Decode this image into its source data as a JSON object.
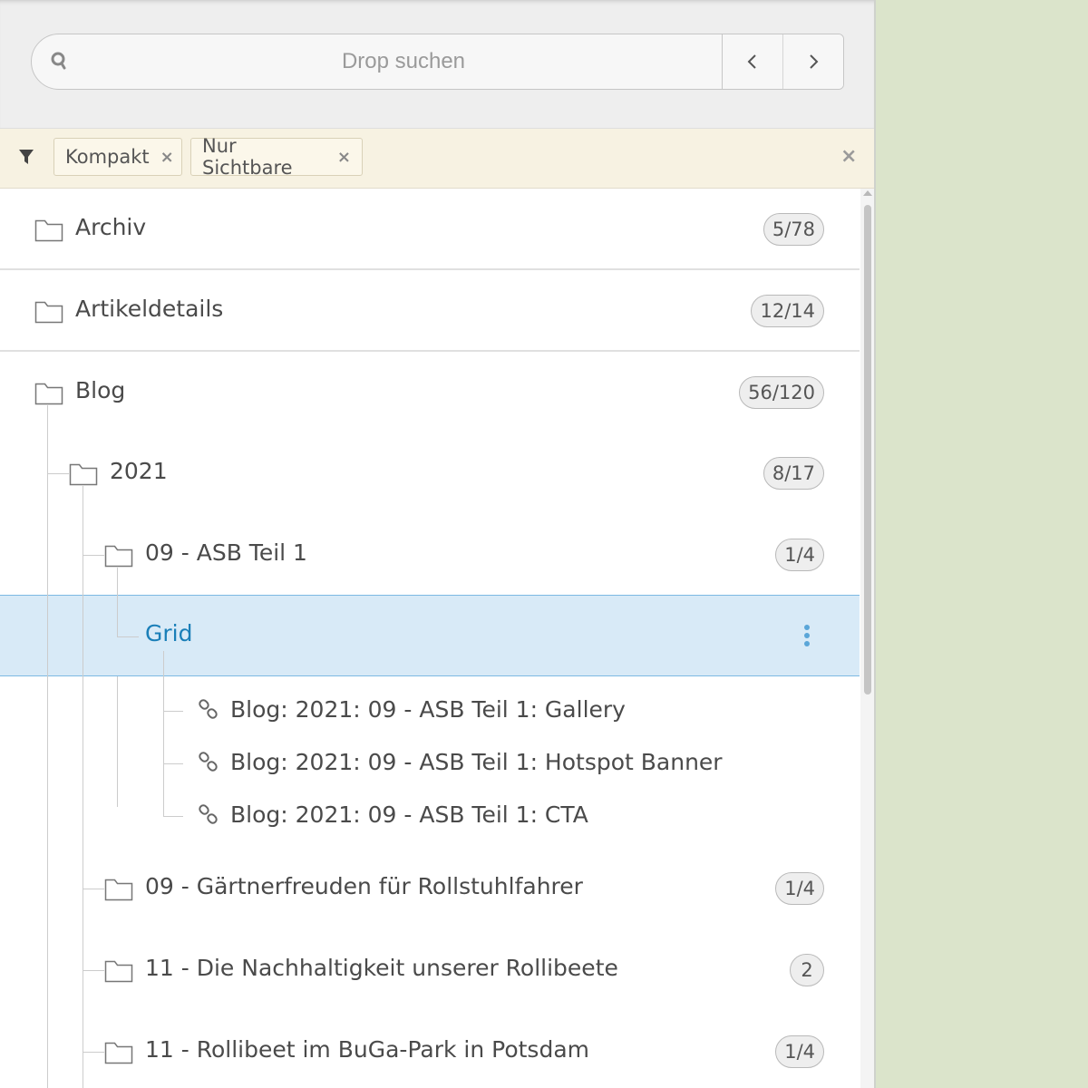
{
  "search": {
    "placeholder": "Drop suchen",
    "prev_label": "‹",
    "next_label": "›"
  },
  "filters": {
    "chips": [
      {
        "label": "Kompakt",
        "remove": "×"
      },
      {
        "label": "Nur Sichtbare",
        "remove": "×"
      }
    ],
    "clear": "×"
  },
  "tree": {
    "items": [
      {
        "label": "Archiv",
        "count": "5/78",
        "icon": "folder-icon"
      },
      {
        "label": "Artikeldetails",
        "count": "12/14",
        "icon": "folder-icon"
      },
      {
        "label": "Blog",
        "count": "56/120",
        "icon": "folder-icon"
      },
      {
        "label": "2021",
        "count": "8/17",
        "icon": "folder-icon"
      },
      {
        "label": "09 - ASB Teil 1",
        "count": "1/4",
        "icon": "folder-icon"
      },
      {
        "label": "Grid",
        "selected": true,
        "icon": "kebab-menu-icon"
      },
      {
        "label": "Blog: 2021: 09 - ASB Teil 1: Gallery",
        "icon": "link-icon"
      },
      {
        "label": "Blog: 2021: 09 - ASB Teil 1: Hotspot Banner",
        "icon": "link-icon"
      },
      {
        "label": "Blog: 2021: 09 - ASB Teil 1: CTA",
        "icon": "link-icon"
      },
      {
        "label": "09 - Gärtnerfreuden für Rollstuhlfahrer",
        "count": "1/4",
        "icon": "folder-icon"
      },
      {
        "label": "11 - Die Nachhaltigkeit unserer Rollibeete",
        "count": "2",
        "icon": "folder-icon"
      },
      {
        "label": "11 - Rollibeet im BuGa-Park in Potsdam",
        "count": "1/4",
        "icon": "folder-icon"
      }
    ]
  },
  "colors": {
    "selected_bg": "#d8eaf7",
    "selected_text": "#1a7fb8",
    "filter_bar": "#f7f2e2",
    "background": "#dbe4cb"
  }
}
